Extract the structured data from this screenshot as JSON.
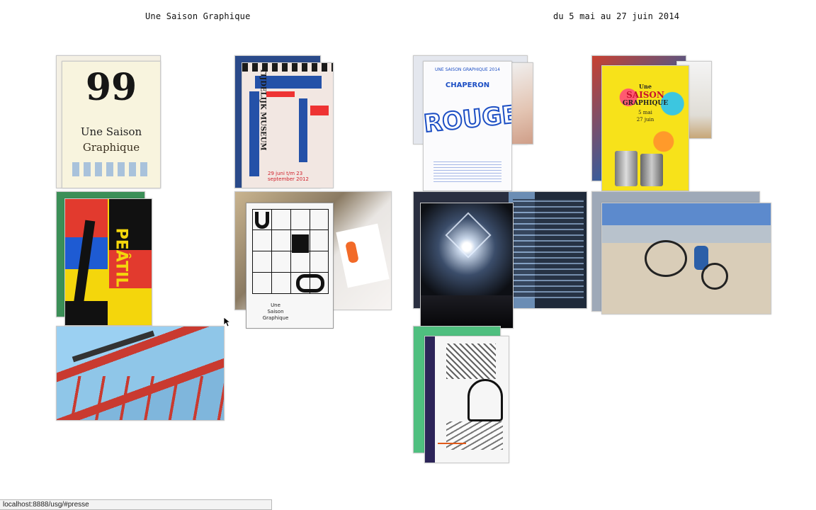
{
  "header": {
    "title": "Une Saison Graphique",
    "dates": "du 5 mai au 27 juin 2014"
  },
  "posters": {
    "p1": {
      "big": "99",
      "line1": "Une Saison",
      "line2": "Graphique"
    },
    "p2": {
      "name": "TIJDELIJK MUSEUM",
      "dates": "29 juni t/m 23 september 2012"
    },
    "p3": {
      "head": "UNE SAISON GRAPHIQUE 2014",
      "sub": "CHAPERON",
      "big": "ROUGE"
    },
    "p4": {
      "line1": "Une",
      "line2": "SAISON",
      "line3": "GRAPHIQUE",
      "date1": "5 mai",
      "date2": "27 juin"
    },
    "p5": {
      "word": "PEÂTIL"
    },
    "p6": {
      "line1": "Une",
      "line2": "Saison",
      "line3": "Graphique"
    }
  },
  "statusbar": {
    "url": "localhost:8888/usg/#presse"
  },
  "colors": {
    "accent_blue": "#1d4fc4",
    "poster_red": "#e23a2e",
    "poster_yellow": "#f7d400",
    "pale_cream": "#f6f2de",
    "green": "#4fbf7f"
  }
}
